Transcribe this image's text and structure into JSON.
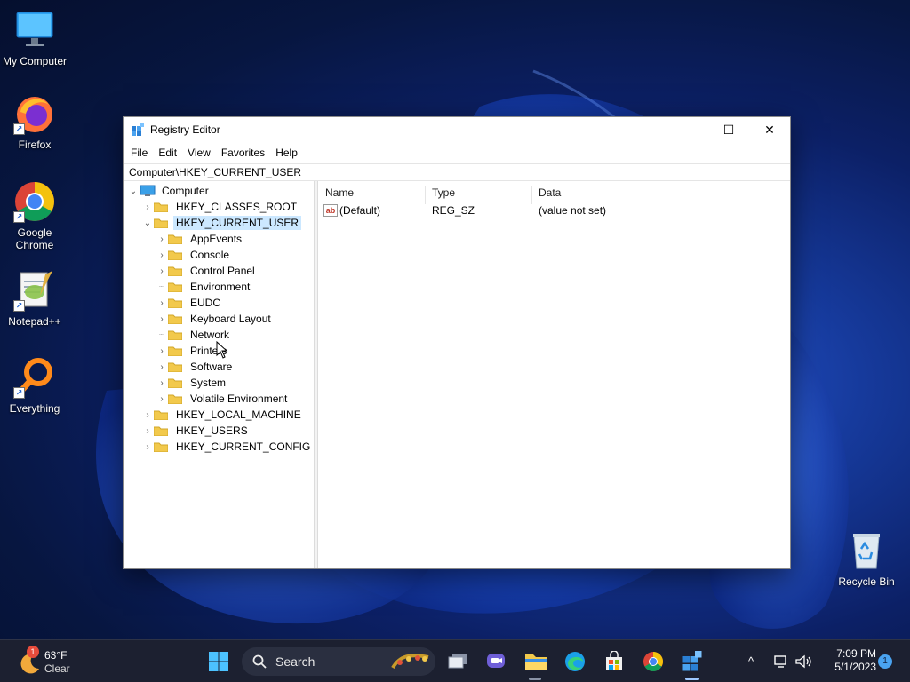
{
  "desktop": {
    "icons": [
      {
        "label": "My Computer"
      },
      {
        "label": "Firefox"
      },
      {
        "label": "Google Chrome"
      },
      {
        "label": "Notepad++"
      },
      {
        "label": "Everything"
      },
      {
        "label": "Recycle Bin"
      }
    ]
  },
  "window": {
    "title": "Registry Editor",
    "minimize": "—",
    "maximize": "☐",
    "close": "✕",
    "menu": [
      "File",
      "Edit",
      "View",
      "Favorites",
      "Help"
    ],
    "address": "Computer\\HKEY_CURRENT_USER",
    "tree": {
      "root": "Computer",
      "hives": {
        "classes_root": "HKEY_CLASSES_ROOT",
        "current_user": "HKEY_CURRENT_USER",
        "local_machine": "HKEY_LOCAL_MACHINE",
        "users": "HKEY_USERS",
        "current_config": "HKEY_CURRENT_CONFIG"
      },
      "current_user_children": [
        "AppEvents",
        "Console",
        "Control Panel",
        "Environment",
        "EUDC",
        "Keyboard Layout",
        "Network",
        "Printers",
        "Software",
        "System",
        "Volatile Environment"
      ]
    },
    "list": {
      "headers": [
        "Name",
        "Type",
        "Data"
      ],
      "rows": [
        {
          "name": "(Default)",
          "type": "REG_SZ",
          "data": "(value not set)",
          "icon": "ab"
        }
      ]
    }
  },
  "taskbar": {
    "weather": {
      "badge": "1",
      "temp": "63°F",
      "condition": "Clear"
    },
    "search_placeholder": "Search",
    "clock": {
      "time": "7:09 PM",
      "date": "5/1/2023"
    },
    "notifications": "1",
    "tray": {
      "chevron": "^"
    }
  },
  "colors": {
    "selection": "#cce8ff",
    "taskbar": "#1c2030",
    "folder": "#f2c94c"
  }
}
